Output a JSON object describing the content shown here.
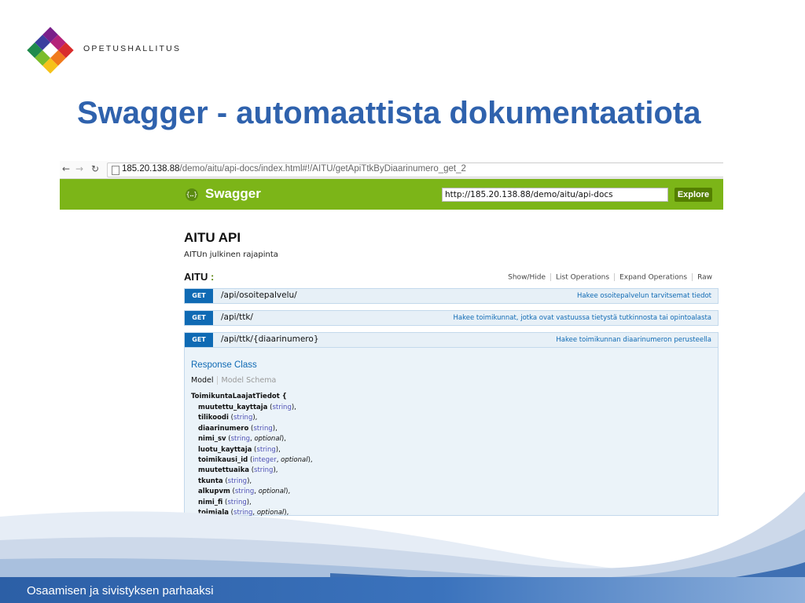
{
  "brand": "OPETUSHALLITUS",
  "slide_title": "Swagger - automaattista dokumentaatiota",
  "browser": {
    "back_icon": "arrow-left-icon",
    "forward_icon": "arrow-right-icon",
    "reload_icon": "reload-icon",
    "url_host": "185.20.138.88",
    "url_path": "/demo/aitu/api-docs/index.html#!/AITU/getApiTtkByDiaarinumero_get_2"
  },
  "swagger": {
    "name": "Swagger",
    "api_url": "http://185.20.138.88/demo/aitu/api-docs",
    "explore": "Explore"
  },
  "api": {
    "title": "AITU API",
    "description": "AITUn julkinen rajapinta",
    "resource": "AITU",
    "resource_colon": ":",
    "links": [
      "Show/Hide",
      "List Operations",
      "Expand Operations",
      "Raw"
    ]
  },
  "operations": [
    {
      "method": "GET",
      "path": "/api/osoitepalvelu/",
      "summary": "Hakee osoitepalvelun tarvitsemat tiedot"
    },
    {
      "method": "GET",
      "path": "/api/ttk/",
      "summary": "Hakee toimikunnat, jotka ovat vastuussa tietystä tutkinnosta tai opintoalasta"
    },
    {
      "method": "GET",
      "path": "/api/ttk/{diaarinumero}",
      "summary": "Hakee toimikunnan diaarinumeron perusteella"
    }
  ],
  "response": {
    "heading": "Response Class",
    "tab_model": "Model",
    "tab_schema": "Model Schema",
    "model_name": "ToimikuntaLaajatTiedot {",
    "properties": [
      {
        "name": "muutettu_kayttaja",
        "type": "string",
        "optional": false
      },
      {
        "name": "tilikoodi",
        "type": "string",
        "optional": false
      },
      {
        "name": "diaarinumero",
        "type": "string",
        "optional": false
      },
      {
        "name": "nimi_sv",
        "type": "string",
        "optional": true
      },
      {
        "name": "luotu_kayttaja",
        "type": "string",
        "optional": false
      },
      {
        "name": "toimikausi_id",
        "type": "integer",
        "optional": true
      },
      {
        "name": "muutettuaika",
        "type": "string",
        "optional": false
      },
      {
        "name": "tkunta",
        "type": "string",
        "optional": false
      },
      {
        "name": "alkupvm",
        "type": "string",
        "optional": true
      },
      {
        "name": "nimi_fi",
        "type": "string",
        "optional": false
      },
      {
        "name": "toimiala",
        "type": "string",
        "optional": true
      }
    ],
    "optional_label": "optional"
  },
  "footer": "Osaamisen ja sivistyksen parhaaksi",
  "colors": {
    "title_blue": "#2f62ad",
    "swagger_green": "#7cb518",
    "get_blue": "#0f6ab4",
    "footer_blue": "#2c5fa6"
  }
}
